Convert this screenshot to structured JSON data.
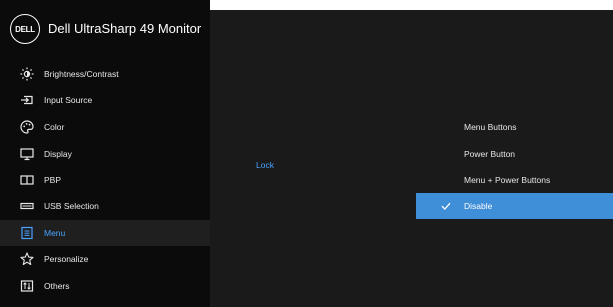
{
  "header": {
    "logo_text": "DELL",
    "title": "Dell UltraSharp 49 Monitor"
  },
  "sidebar": {
    "items": [
      {
        "label": "Brightness/Contrast",
        "icon": "brightness-icon"
      },
      {
        "label": "Input Source",
        "icon": "input-source-icon"
      },
      {
        "label": "Color",
        "icon": "color-palette-icon"
      },
      {
        "label": "Display",
        "icon": "display-icon"
      },
      {
        "label": "PBP",
        "icon": "pbp-icon"
      },
      {
        "label": "USB Selection",
        "icon": "usb-icon"
      },
      {
        "label": "Menu",
        "icon": "menu-icon",
        "active": true
      },
      {
        "label": "Personalize",
        "icon": "star-icon"
      },
      {
        "label": "Others",
        "icon": "others-icon"
      }
    ]
  },
  "main": {
    "lock_label": "Lock",
    "options": [
      {
        "label": "Menu Buttons"
      },
      {
        "label": "Power Button"
      },
      {
        "label": "Menu + Power Buttons"
      },
      {
        "label": "Disable",
        "selected": true
      }
    ]
  },
  "colors": {
    "accent": "#4aa3ff",
    "selected": "#3f8ed8",
    "sidebar_bg": "#0b0b0b",
    "panel_bg": "#1a1a1a"
  }
}
